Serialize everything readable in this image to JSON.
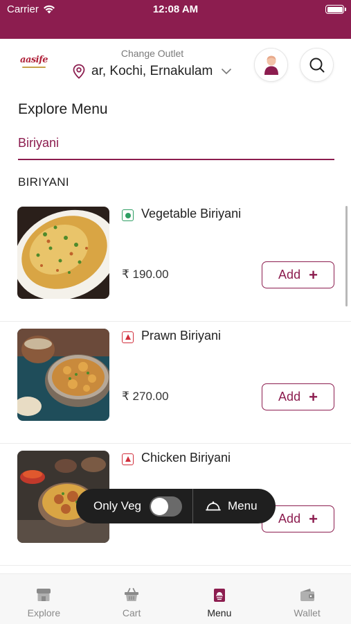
{
  "status_bar": {
    "carrier": "Carrier",
    "time": "12:08 AM"
  },
  "header": {
    "logo_text": "aasife",
    "change_outlet_label": "Change Outlet",
    "location": "ar, Kochi, Ernakulam"
  },
  "explore": {
    "title": "Explore Menu",
    "active_tab": "Biriyani"
  },
  "section": {
    "title": "BIRIYANI",
    "items": [
      {
        "name": "Vegetable Biriyani",
        "price": "₹ 190.00",
        "type": "veg",
        "add_label": "Add"
      },
      {
        "name": "Prawn Biriyani",
        "price": "₹ 270.00",
        "type": "non-veg",
        "add_label": "Add"
      },
      {
        "name": "Chicken Biriyani",
        "price": "",
        "type": "non-veg",
        "add_label": "Add"
      }
    ]
  },
  "floating_bar": {
    "only_veg_label": "Only Veg",
    "only_veg_enabled": false,
    "menu_label": "Menu"
  },
  "bottom_nav": {
    "items": [
      {
        "label": "Explore",
        "icon": "store-icon",
        "active": false
      },
      {
        "label": "Cart",
        "icon": "basket-icon",
        "active": false
      },
      {
        "label": "Menu",
        "icon": "menu-book-icon",
        "active": true
      },
      {
        "label": "Wallet",
        "icon": "wallet-icon",
        "active": false
      }
    ]
  },
  "colors": {
    "brand": "#8c1d4f",
    "veg": "#2e9e63",
    "nonveg": "#d12e3b",
    "pill": "#1f1f1f"
  }
}
